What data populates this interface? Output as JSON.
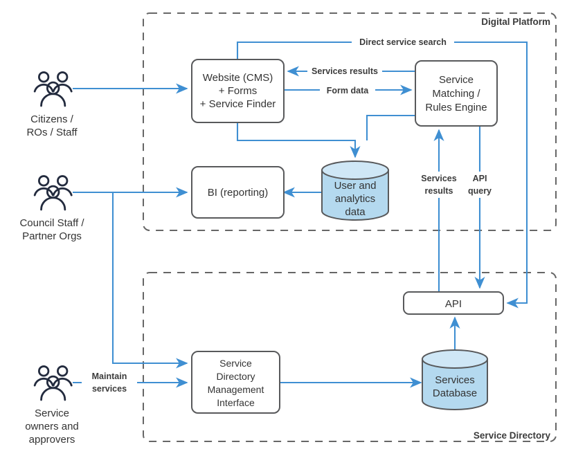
{
  "diagram": {
    "title": "Digital Platform and Service Directory architecture",
    "colors": {
      "flow": "#3f8fd2",
      "node_stroke": "#58595b",
      "node_fill": "#ffffff",
      "cylinder_fill": "#b4d9ef",
      "cylinder_top_fill": "#cfe7f6",
      "group_stroke": "#666666",
      "actor_stroke": "#232b3e",
      "text": "#333333",
      "background": "#ffffff"
    },
    "groups": [
      {
        "id": "digital-platform",
        "label": "Digital Platform"
      },
      {
        "id": "service-directory",
        "label": "Service Directory"
      }
    ],
    "actors": [
      {
        "id": "citizens",
        "icon": "people-group-icon",
        "label_line1": "Citizens /",
        "label_line2": "ROs / Staff"
      },
      {
        "id": "council-staff",
        "icon": "people-group-icon",
        "label_line1": "Council Staff /",
        "label_line2": "Partner Orgs"
      },
      {
        "id": "service-owners",
        "icon": "people-group-icon",
        "label_line1": "Service",
        "label_line2": "owners and",
        "label_line3": "approvers"
      }
    ],
    "nodes": [
      {
        "id": "website",
        "shape": "box",
        "label_line1": "Website (CMS)",
        "label_line2": "+ Forms",
        "label_line3": "+ Service Finder"
      },
      {
        "id": "service-matching",
        "shape": "box",
        "label_line1": "Service",
        "label_line2": "Matching /",
        "label_line3": "Rules Engine"
      },
      {
        "id": "bi-reporting",
        "shape": "box",
        "label_line1": "BI (reporting)"
      },
      {
        "id": "user-analytics-data",
        "shape": "cylinder",
        "label_line1": "User and",
        "label_line2": "analytics",
        "label_line3": "data"
      },
      {
        "id": "api",
        "shape": "box",
        "label_line1": "API"
      },
      {
        "id": "sdmi",
        "shape": "box",
        "label_line1": "Service",
        "label_line2": "Directory",
        "label_line3": "Management",
        "label_line4": "Interface"
      },
      {
        "id": "services-database",
        "shape": "cylinder",
        "label_line1": "Services",
        "label_line2": "Database"
      }
    ],
    "edge_labels": [
      {
        "id": "direct-service-search",
        "text": "Direct service search"
      },
      {
        "id": "services-results-top",
        "text": "Services results"
      },
      {
        "id": "form-data",
        "text": "Form data"
      },
      {
        "id": "services-results-vertical-l1",
        "text": "Services"
      },
      {
        "id": "services-results-vertical-l2",
        "text": "results"
      },
      {
        "id": "api-query-l1",
        "text": "API"
      },
      {
        "id": "api-query-l2",
        "text": "query"
      },
      {
        "id": "maintain-services-l1",
        "text": "Maintain"
      },
      {
        "id": "maintain-services-l2",
        "text": "services"
      }
    ]
  }
}
